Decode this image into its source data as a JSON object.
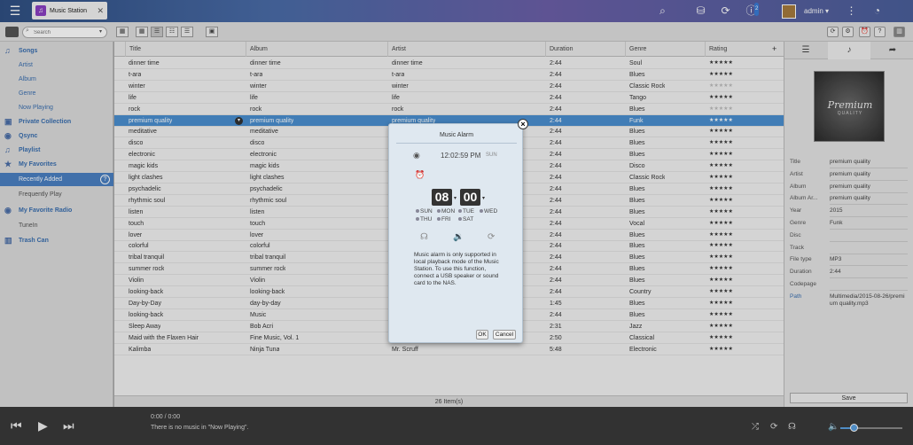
{
  "app": {
    "tab_title": "Music Station",
    "user": "admin",
    "notification_count": "2"
  },
  "search": {
    "placeholder": "Search"
  },
  "sidebar": [
    {
      "label": "Songs",
      "icon": "♫",
      "style": ""
    },
    {
      "label": "Artist",
      "icon": "",
      "style": "sub"
    },
    {
      "label": "Album",
      "icon": "",
      "style": "sub"
    },
    {
      "label": "Genre",
      "icon": "",
      "style": "sub"
    },
    {
      "label": "Now Playing",
      "icon": "",
      "style": "sub"
    },
    {
      "label": "Private Collection",
      "icon": "▣",
      "style": ""
    },
    {
      "label": "Qsync",
      "icon": "◉",
      "style": ""
    },
    {
      "label": "Playlist",
      "icon": "♫",
      "style": ""
    },
    {
      "label": "My Favorites",
      "icon": "★",
      "style": ""
    },
    {
      "label": "Recently Added",
      "icon": "",
      "style": "active"
    },
    {
      "label": "Frequently Play",
      "icon": "",
      "style": "grey"
    },
    {
      "label": "My Favorite Radio",
      "icon": "◉",
      "style": ""
    },
    {
      "label": "TuneIn",
      "icon": "",
      "style": "grey"
    },
    {
      "label": "Trash Can",
      "icon": "▥",
      "style": ""
    }
  ],
  "columns": [
    "Title",
    "Album",
    "Artist",
    "Duration",
    "Genre",
    "Rating"
  ],
  "songs": [
    {
      "title": "dinner time",
      "album": "dinner time",
      "artist": "dinner time",
      "duration": "2:44",
      "genre": "Soul",
      "rating": "★★★★★",
      "rated": true
    },
    {
      "title": "t-ara",
      "album": "t-ara",
      "artist": "t-ara",
      "duration": "2:44",
      "genre": "Blues",
      "rating": "★★★★★",
      "rated": true
    },
    {
      "title": "winter",
      "album": "winter",
      "artist": "winter",
      "duration": "2:44",
      "genre": "Classic Rock",
      "rating": "★★★★★",
      "rated": false
    },
    {
      "title": "life",
      "album": "life",
      "artist": "life",
      "duration": "2:44",
      "genre": "Tango",
      "rating": "★★★★★",
      "rated": true
    },
    {
      "title": "rock",
      "album": "rock",
      "artist": "rock",
      "duration": "2:44",
      "genre": "Blues",
      "rating": "★★★★★",
      "rated": false
    },
    {
      "title": "premium quality",
      "album": "premium quality",
      "artist": "premium quality",
      "duration": "2:44",
      "genre": "Funk",
      "rating": "★★★★★",
      "rated": true
    },
    {
      "title": "meditative",
      "album": "meditative",
      "artist": "",
      "duration": "2:44",
      "genre": "Blues",
      "rating": "★★★★★",
      "rated": true
    },
    {
      "title": "disco",
      "album": "disco",
      "artist": "",
      "duration": "2:44",
      "genre": "Blues",
      "rating": "★★★★★",
      "rated": true
    },
    {
      "title": "electronic",
      "album": "electronic",
      "artist": "",
      "duration": "2:44",
      "genre": "Blues",
      "rating": "★★★★★",
      "rated": true
    },
    {
      "title": "magic kids",
      "album": "magic kids",
      "artist": "",
      "duration": "2:44",
      "genre": "Disco",
      "rating": "★★★★★",
      "rated": true
    },
    {
      "title": "light clashes",
      "album": "light clashes",
      "artist": "",
      "duration": "2:44",
      "genre": "Classic Rock",
      "rating": "★★★★★",
      "rated": true
    },
    {
      "title": "psychadelic",
      "album": "psychadelic",
      "artist": "",
      "duration": "2:44",
      "genre": "Blues",
      "rating": "★★★★★",
      "rated": true
    },
    {
      "title": "rhythmic soul",
      "album": "rhythmic soul",
      "artist": "",
      "duration": "2:44",
      "genre": "Blues",
      "rating": "★★★★★",
      "rated": true
    },
    {
      "title": "listen",
      "album": "listen",
      "artist": "",
      "duration": "2:44",
      "genre": "Blues",
      "rating": "★★★★★",
      "rated": true
    },
    {
      "title": "touch",
      "album": "touch",
      "artist": "",
      "duration": "2:44",
      "genre": "Vocal",
      "rating": "★★★★★",
      "rated": true
    },
    {
      "title": "lover",
      "album": "lover",
      "artist": "",
      "duration": "2:44",
      "genre": "Blues",
      "rating": "★★★★★",
      "rated": true
    },
    {
      "title": "colorful",
      "album": "colorful",
      "artist": "",
      "duration": "2:44",
      "genre": "Blues",
      "rating": "★★★★★",
      "rated": true
    },
    {
      "title": "tribal tranquil",
      "album": "tribal tranquil",
      "artist": "",
      "duration": "2:44",
      "genre": "Blues",
      "rating": "★★★★★",
      "rated": true
    },
    {
      "title": "summer rock",
      "album": "summer rock",
      "artist": "",
      "duration": "2:44",
      "genre": "Blues",
      "rating": "★★★★★",
      "rated": true
    },
    {
      "title": "Violin",
      "album": "Violin",
      "artist": "",
      "duration": "2:44",
      "genre": "Blues",
      "rating": "★★★★★",
      "rated": true
    },
    {
      "title": "looking-back",
      "album": "looking-back",
      "artist": "",
      "duration": "2:44",
      "genre": "Country",
      "rating": "★★★★★",
      "rated": true
    },
    {
      "title": "Day-by-Day",
      "album": "day-by-day",
      "artist": "",
      "duration": "1:45",
      "genre": "Blues",
      "rating": "★★★★★",
      "rated": true
    },
    {
      "title": "looking-back",
      "album": "Music",
      "artist": "",
      "duration": "2:44",
      "genre": "Blues",
      "rating": "★★★★★",
      "rated": true
    },
    {
      "title": "Sleep Away",
      "album": "Bob Acri",
      "artist": "",
      "duration": "2:31",
      "genre": "Jazz",
      "rating": "★★★★★",
      "rated": true
    },
    {
      "title": "Maid with the Flaxen Hair",
      "album": "Fine Music, Vol. 1",
      "artist": "",
      "duration": "2:50",
      "genre": "Classical",
      "rating": "★★★★★",
      "rated": true
    },
    {
      "title": "Kalimba",
      "album": "Ninja Tuna",
      "artist": "Mr. Scruff",
      "duration": "5:48",
      "genre": "Electronic",
      "rating": "★★★★★",
      "rated": true
    }
  ],
  "status": "26 Item(s)",
  "info": {
    "cover_title": "Premium",
    "cover_sub": "QUALITY",
    "fields": [
      {
        "label": "Title",
        "value": "premium quality"
      },
      {
        "label": "Artist",
        "value": "premium quality"
      },
      {
        "label": "Album",
        "value": "premium quality"
      },
      {
        "label": "Album Ar...",
        "value": "premium quality"
      },
      {
        "label": "Year",
        "value": "2015"
      },
      {
        "label": "Genre",
        "value": "Funk"
      },
      {
        "label": "Disc",
        "value": ""
      },
      {
        "label": "Track",
        "value": ""
      },
      {
        "label": "File type",
        "value": "MP3"
      },
      {
        "label": "Duration",
        "value": "2:44"
      },
      {
        "label": "Codepage",
        "value": ""
      }
    ],
    "path_label": "Path",
    "path_value": "Multimedia/2015-08-26/premium quality.mp3",
    "save_label": "Save"
  },
  "player": {
    "time": "0:00 / 0:00",
    "message": "There is no music in \"Now Playing\".",
    "volume": 0.22
  },
  "dialog": {
    "title": "Music Alarm",
    "current_time": "12:02:59 PM",
    "current_day": "SUN",
    "hour": "08",
    "minute": "00",
    "days_row1": [
      "SUN",
      "MON",
      "TUE",
      "WED"
    ],
    "days_row2": [
      "THU",
      "FRI",
      "SAT"
    ],
    "note": "Music alarm is only supported in local playback mode of the Music Station. To use this function, connect a USB speaker or sound card to the NAS.",
    "ok": "OK",
    "cancel": "Cancel"
  }
}
